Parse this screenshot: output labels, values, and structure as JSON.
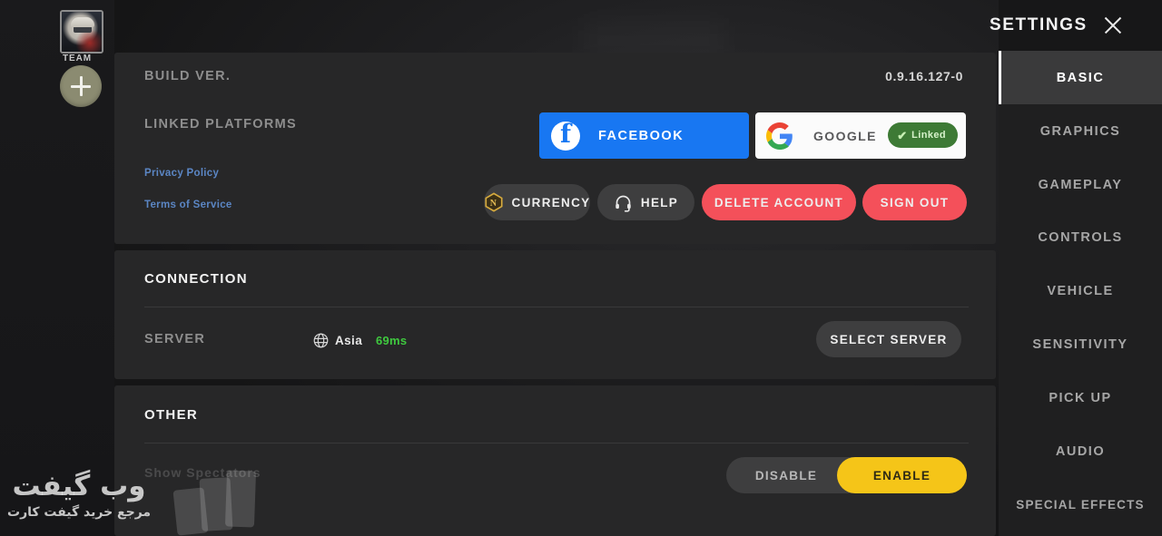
{
  "team": {
    "label": "TEAM",
    "avatar_icon": "player-avatar",
    "add_icon": "plus-icon"
  },
  "basic": {
    "build": {
      "label": "BUILD VER.",
      "value": "0.9.16.127-0"
    },
    "linked_platforms": {
      "label": "LINKED PLATFORMS",
      "facebook": {
        "label": "FACEBOOK",
        "icon": "facebook-icon",
        "color": "#1877f2"
      },
      "google": {
        "label": "GOOGLE",
        "icon": "google-icon",
        "badge": "Linked",
        "badge_check": "✔",
        "badge_color": "#3d7a35"
      }
    },
    "links": [
      {
        "label": "Privacy Policy"
      },
      {
        "label": "Terms of Service"
      }
    ],
    "actions": [
      {
        "label": "CURRENCY",
        "icon": "currency-coin-icon",
        "style": "dark"
      },
      {
        "label": "HELP",
        "icon": "headset-icon",
        "style": "dark"
      },
      {
        "label": "DELETE ACCOUNT",
        "icon": "",
        "style": "red"
      },
      {
        "label": "SIGN OUT",
        "icon": "",
        "style": "red"
      }
    ]
  },
  "connection": {
    "title": "CONNECTION",
    "server": {
      "label": "SERVER",
      "icon": "globe-icon",
      "region": "Asia",
      "ping": "69ms",
      "ping_color": "#3fc93f",
      "button": "SELECT SERVER"
    }
  },
  "other": {
    "title": "OTHER",
    "setting": {
      "label": "Show Spectators",
      "disable_label": "DISABLE",
      "enable_label": "ENABLE",
      "selected": "ENABLE",
      "accent_color": "#f5c518"
    }
  },
  "settings_panel": {
    "title": "SETTINGS",
    "close_icon": "close-icon",
    "tabs": [
      {
        "label": "BASIC",
        "active": true
      },
      {
        "label": "GRAPHICS",
        "active": false
      },
      {
        "label": "GAMEPLAY",
        "active": false
      },
      {
        "label": "CONTROLS",
        "active": false
      },
      {
        "label": "VEHICLE",
        "active": false
      },
      {
        "label": "SENSITIVITY",
        "active": false
      },
      {
        "label": "PICK UP",
        "active": false
      },
      {
        "label": "AUDIO",
        "active": false
      },
      {
        "label": "SPECIAL EFFECTS",
        "active": false
      }
    ]
  },
  "watermark": {
    "main": "وب گیفت",
    "sub": "مرجع خرید گیفت کارت"
  }
}
